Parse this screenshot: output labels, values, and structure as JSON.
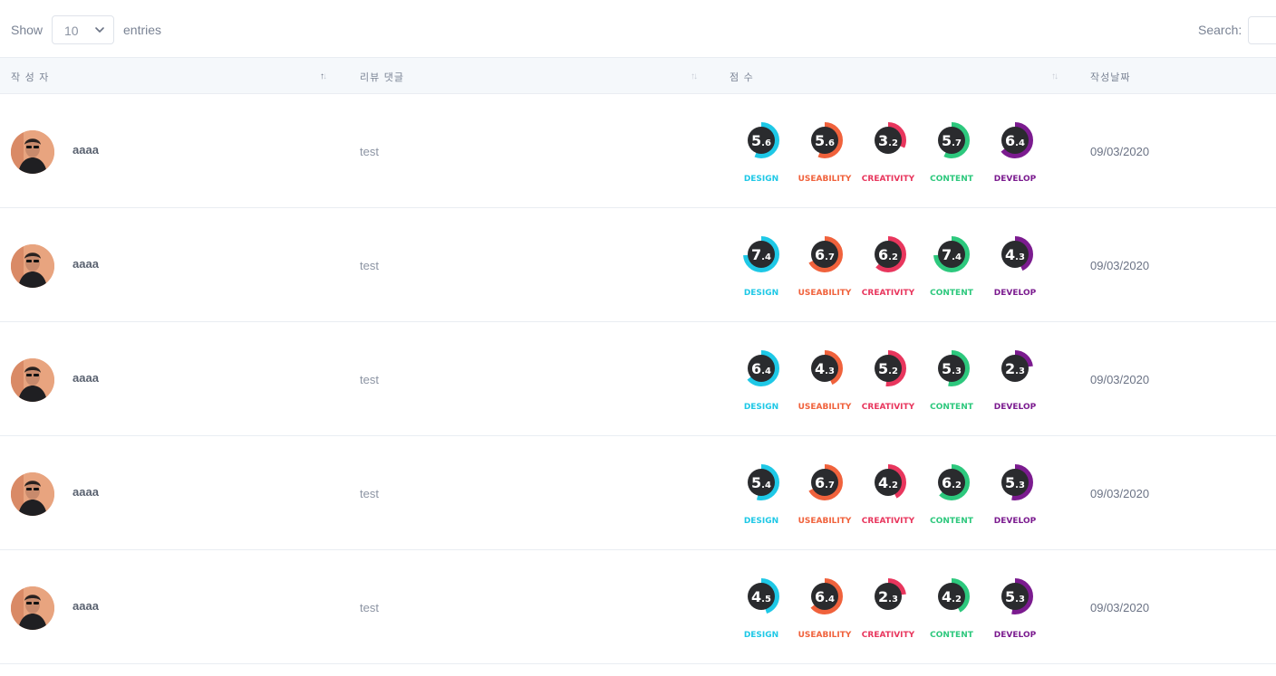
{
  "controls": {
    "show_label": "Show",
    "entries_value": "10",
    "entries_label": "entries",
    "search_label": "Search:",
    "search_value": ""
  },
  "headers": {
    "author": "작 성 자",
    "comment": "리뷰 댓글",
    "score": "점 수",
    "date": "작성날짜"
  },
  "score_categories": [
    {
      "label": "DESIGN",
      "color": "#1ec8e6"
    },
    {
      "label": "USEABILITY",
      "color": "#f0623c"
    },
    {
      "label": "CREATIVITY",
      "color": "#e8365d"
    },
    {
      "label": "CONTENT",
      "color": "#2dc87d"
    },
    {
      "label": "DEVELOP",
      "color": "#7b1b8f"
    }
  ],
  "rows": [
    {
      "author": "aaaa",
      "comment": "test",
      "date": "09/03/2020",
      "scores": [
        {
          "int": "5",
          "dec": "6",
          "value": 5.6
        },
        {
          "int": "5",
          "dec": "6",
          "value": 5.6
        },
        {
          "int": "3",
          "dec": "2",
          "value": 3.2
        },
        {
          "int": "5",
          "dec": "7",
          "value": 5.7
        },
        {
          "int": "6",
          "dec": "4",
          "value": 6.4
        }
      ]
    },
    {
      "author": "aaaa",
      "comment": "test",
      "date": "09/03/2020",
      "scores": [
        {
          "int": "7",
          "dec": "4",
          "value": 7.4
        },
        {
          "int": "6",
          "dec": "7",
          "value": 6.7
        },
        {
          "int": "6",
          "dec": "2",
          "value": 6.2
        },
        {
          "int": "7",
          "dec": "4",
          "value": 7.4
        },
        {
          "int": "4",
          "dec": "3",
          "value": 4.3
        }
      ]
    },
    {
      "author": "aaaa",
      "comment": "test",
      "date": "09/03/2020",
      "scores": [
        {
          "int": "6",
          "dec": "4",
          "value": 6.4
        },
        {
          "int": "4",
          "dec": "3",
          "value": 4.3
        },
        {
          "int": "5",
          "dec": "2",
          "value": 5.2
        },
        {
          "int": "5",
          "dec": "3",
          "value": 5.3
        },
        {
          "int": "2",
          "dec": "3",
          "value": 2.3
        }
      ]
    },
    {
      "author": "aaaa",
      "comment": "test",
      "date": "09/03/2020",
      "scores": [
        {
          "int": "5",
          "dec": "4",
          "value": 5.4
        },
        {
          "int": "6",
          "dec": "7",
          "value": 6.7
        },
        {
          "int": "4",
          "dec": "2",
          "value": 4.2
        },
        {
          "int": "6",
          "dec": "2",
          "value": 6.2
        },
        {
          "int": "5",
          "dec": "3",
          "value": 5.3
        }
      ]
    },
    {
      "author": "aaaa",
      "comment": "test",
      "date": "09/03/2020",
      "scores": [
        {
          "int": "4",
          "dec": "5",
          "value": 4.5
        },
        {
          "int": "6",
          "dec": "4",
          "value": 6.4
        },
        {
          "int": "2",
          "dec": "3",
          "value": 2.3
        },
        {
          "int": "4",
          "dec": "2",
          "value": 4.2
        },
        {
          "int": "5",
          "dec": "3",
          "value": 5.3
        }
      ]
    }
  ]
}
